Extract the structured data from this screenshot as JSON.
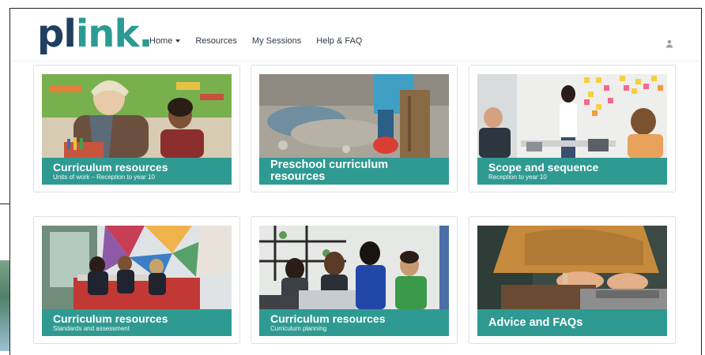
{
  "logo": {
    "part1": "pl",
    "part2": "ink",
    "dot": "."
  },
  "nav": {
    "items": [
      {
        "label": "Home"
      },
      {
        "label": "Resources"
      },
      {
        "label": "My Sessions"
      },
      {
        "label": "Help & FAQ"
      }
    ]
  },
  "user": {
    "icon": "user-icon"
  },
  "cards": [
    {
      "title": "Curriculum resources",
      "subtitle": "Units of work – Reception to year 10"
    },
    {
      "title": "Preschool curriculum resources",
      "subtitle": ""
    },
    {
      "title": "Scope and sequence",
      "subtitle": "Reception to year 10"
    },
    {
      "title": "Curriculum resources",
      "subtitle": "Standards and assessment"
    },
    {
      "title": "Curriculum resources",
      "subtitle": "Curriculum planning"
    },
    {
      "title": "Advice and FAQs",
      "subtitle": ""
    }
  ],
  "colors": {
    "brand_dark": "#203e5f",
    "brand_teal": "#2b9b94",
    "card_label": "#2f9a92"
  }
}
